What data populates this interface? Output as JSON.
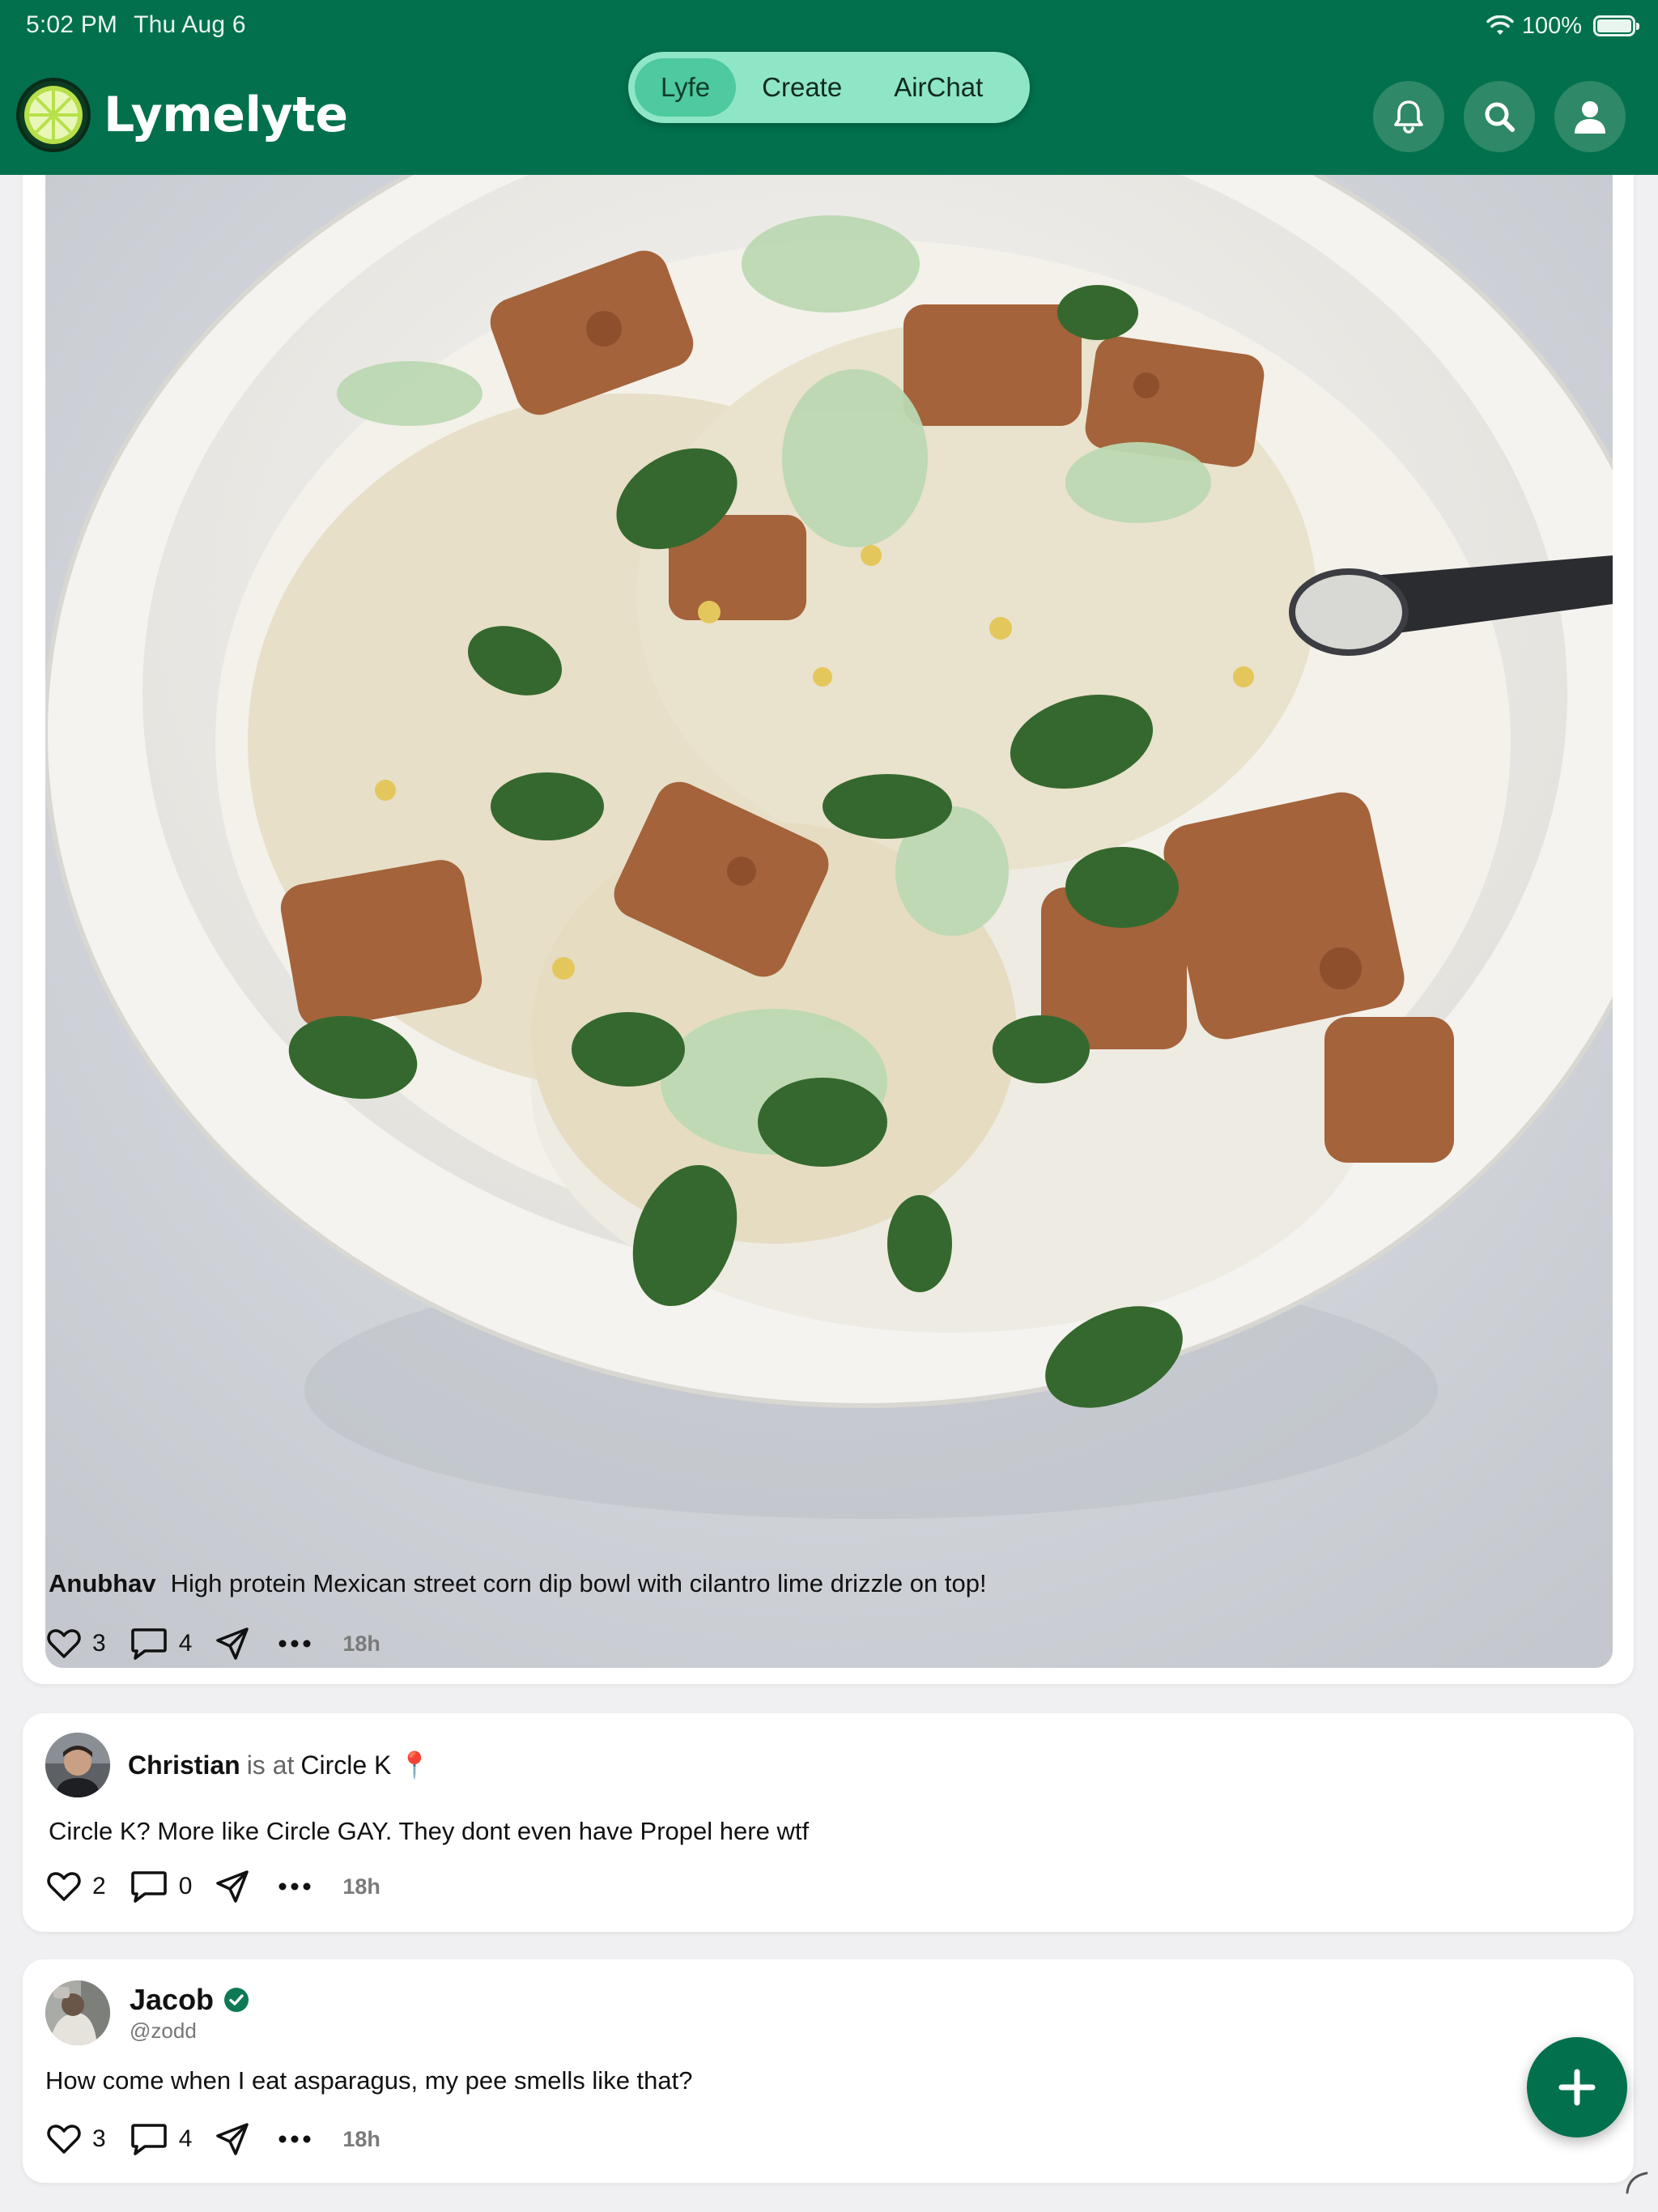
{
  "status_bar": {
    "time": "5:02 PM",
    "date": "Thu Aug 6",
    "battery": "100%",
    "battery_level": 1.0
  },
  "header": {
    "app_name": "Lymelyte",
    "tabs": [
      {
        "label": "Lyfe",
        "active": true
      },
      {
        "label": "Create",
        "active": false
      },
      {
        "label": "AirChat",
        "active": false
      }
    ],
    "icons": [
      "bell-icon",
      "search-icon",
      "profile-icon"
    ]
  },
  "posts": [
    {
      "author": "Anubhav",
      "caption": "High protein Mexican street corn dip bowl with cilantro lime drizzle on top!",
      "likes": "3",
      "comments": "4",
      "time": "18h"
    },
    {
      "author": "Christian",
      "is_at": "is at",
      "place": "Circle K",
      "pin": "📍",
      "text": "Circle K? More like Circle GAY. They dont even have Propel here wtf",
      "likes": "2",
      "comments": "0",
      "time": "18h"
    },
    {
      "author": "Jacob",
      "handle": "@zodd",
      "verified": true,
      "text": "How come when I eat asparagus, my pee smells like that?",
      "likes": "3",
      "comments": "4",
      "time": "18h"
    }
  ],
  "colors": {
    "brand": "#02704d",
    "segment_bg": "#8fe6c6",
    "segment_active": "#4fc99f",
    "card": "#ffffff",
    "page": "#f0f0f2"
  }
}
